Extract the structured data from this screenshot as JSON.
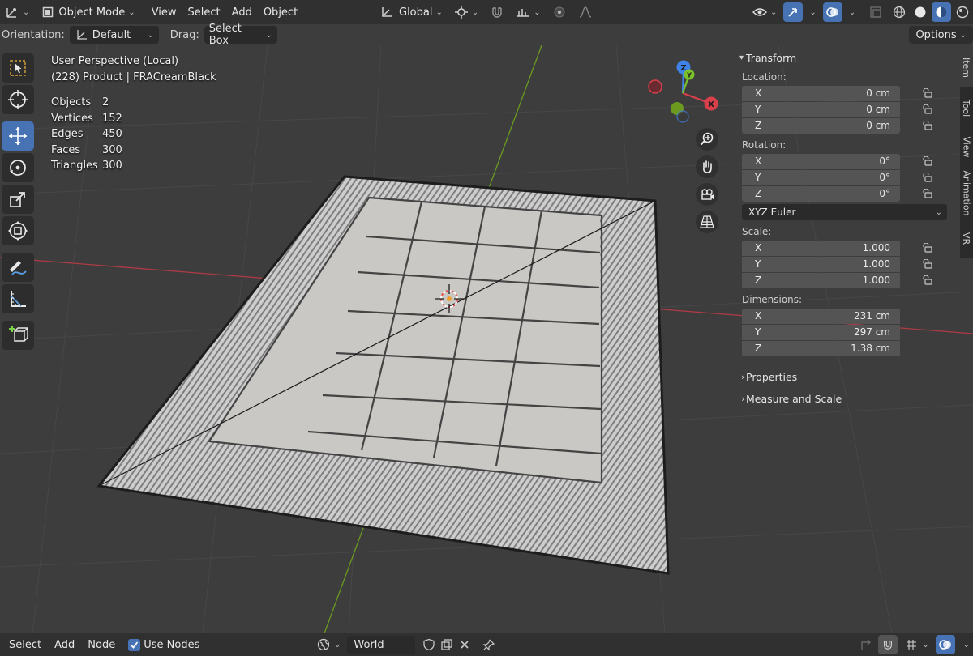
{
  "header": {
    "mode": "Object Mode",
    "menus": [
      "View",
      "Select",
      "Add",
      "Object"
    ],
    "transform_orientation": "Global",
    "options_label": "Options"
  },
  "tool_header": {
    "orientation_label": "Orientation:",
    "orientation_value": "Default",
    "drag_label": "Drag:",
    "drag_value": "Select Box"
  },
  "viewport": {
    "view_name": "User Perspective (Local)",
    "active_object": "(228) Product | FRACreamBlack",
    "stats": [
      {
        "label": "Objects",
        "value": "2"
      },
      {
        "label": "Vertices",
        "value": "152"
      },
      {
        "label": "Edges",
        "value": "450"
      },
      {
        "label": "Faces",
        "value": "300"
      },
      {
        "label": "Triangles",
        "value": "300"
      }
    ],
    "gizmo": {
      "x": "X",
      "y": "Y",
      "z": "Z"
    }
  },
  "toolbar": {
    "tools": [
      "select-box",
      "cursor",
      "move",
      "rotate",
      "scale",
      "transform",
      "annotate",
      "measure",
      "add-cube"
    ],
    "active": "move"
  },
  "npanel": {
    "transform_title": "Transform",
    "location_label": "Location:",
    "location": [
      {
        "axis": "X",
        "value": "0 cm"
      },
      {
        "axis": "Y",
        "value": "0 cm"
      },
      {
        "axis": "Z",
        "value": "0 cm"
      }
    ],
    "rotation_label": "Rotation:",
    "rotation": [
      {
        "axis": "X",
        "value": "0°"
      },
      {
        "axis": "Y",
        "value": "0°"
      },
      {
        "axis": "Z",
        "value": "0°"
      }
    ],
    "rotation_mode": "XYZ Euler",
    "scale_label": "Scale:",
    "scale": [
      {
        "axis": "X",
        "value": "1.000"
      },
      {
        "axis": "Y",
        "value": "1.000"
      },
      {
        "axis": "Z",
        "value": "1.000"
      }
    ],
    "dimensions_label": "Dimensions:",
    "dimensions": [
      {
        "axis": "X",
        "value": "231 cm"
      },
      {
        "axis": "Y",
        "value": "297 cm"
      },
      {
        "axis": "Z",
        "value": "1.38 cm"
      }
    ],
    "properties_label": "Properties",
    "measure_label": "Measure and Scale"
  },
  "sidetabs": [
    "Item",
    "Tool",
    "View",
    "Animation",
    "VR"
  ],
  "footer": {
    "select": "Select",
    "add": "Add",
    "node": "Node",
    "use_nodes": "Use Nodes",
    "world": "World"
  },
  "colors": {
    "accent": "#4772b3",
    "x_axis": "#e0424f",
    "y_axis": "#6aa821",
    "z_axis": "#3b82e6"
  }
}
